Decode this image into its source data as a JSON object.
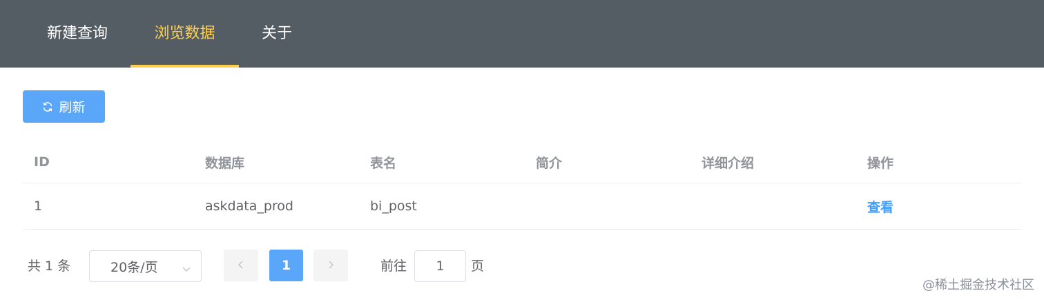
{
  "nav": {
    "items": [
      {
        "label": "新建查询",
        "active": false
      },
      {
        "label": "浏览数据",
        "active": true
      },
      {
        "label": "关于",
        "active": false
      }
    ],
    "background": "#545c64",
    "active_color": "#ffd04b"
  },
  "toolbar": {
    "refresh_label": "刷新",
    "refresh_icon": "refresh-icon"
  },
  "table": {
    "columns": [
      "ID",
      "数据库",
      "表名",
      "简介",
      "详细介绍",
      "操作"
    ],
    "rows": [
      {
        "id": "1",
        "database": "askdata_prod",
        "table_name": "bi_post",
        "summary": "",
        "detail": "",
        "action": "查看"
      }
    ]
  },
  "pagination": {
    "total_text": "共 1 条",
    "page_size": "20条/页",
    "current_page": "1",
    "goto_prefix": "前往",
    "goto_value": "1",
    "goto_suffix": "页"
  },
  "watermark": "@稀土掘金技术社区",
  "colors": {
    "primary": "#409eff",
    "button": "#5aa6f8"
  }
}
